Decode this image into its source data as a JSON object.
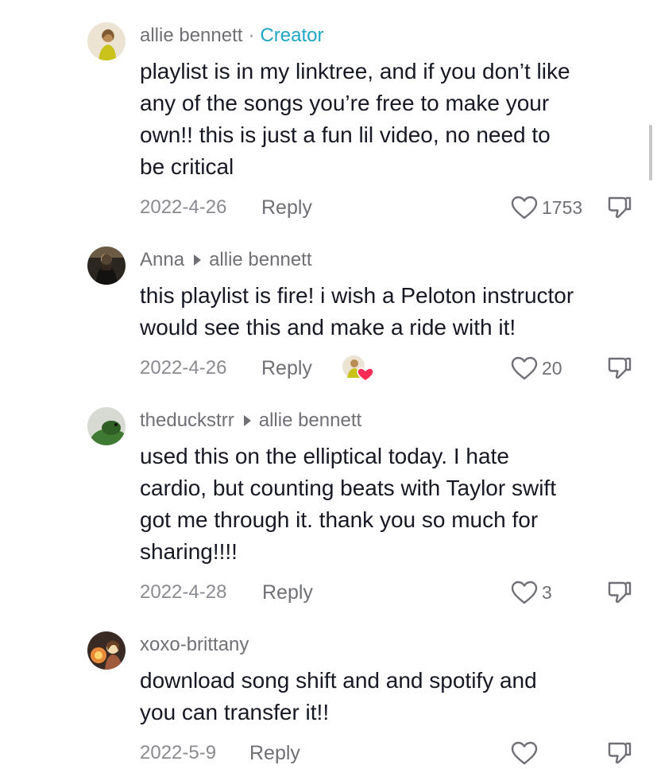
{
  "comments": [
    {
      "username": "allie bennett",
      "separator": "·",
      "badge": "Creator",
      "reply_to": "",
      "text": "playlist is in my linktree, and if you don’t like\nany of the songs you’re free to make your\nown!! this is just a fun lil video, no need to\nbe critical",
      "date": "2022-4-26",
      "reply_label": "Reply",
      "likes": "1753",
      "liked_by_creator": false,
      "avatar_colors": [
        "#e9dcc7",
        "#b98d55",
        "#c9c21a"
      ]
    },
    {
      "username": "Anna",
      "separator": "",
      "badge": "",
      "reply_to": "allie bennett",
      "text": "this playlist is fire! i wish a Peloton instructor\nwould see this and make a ride with it!",
      "date": "2022-4-26",
      "reply_label": "Reply",
      "likes": "20",
      "liked_by_creator": true,
      "avatar_colors": [
        "#2b2620",
        "#6b5a44",
        "#141210"
      ]
    },
    {
      "username": "theduckstrr",
      "separator": "",
      "badge": "",
      "reply_to": "allie bennett",
      "text": "used this on the elliptical today. I hate\ncardio, but counting beats with Taylor swift\ngot me through it. thank you so much for\nsharing!!!!",
      "date": "2022-4-28",
      "reply_label": "Reply",
      "likes": "3",
      "liked_by_creator": false,
      "avatar_colors": [
        "#d7d9d3",
        "#3f7a32",
        "#2f5f24"
      ]
    },
    {
      "username": "xoxo-brittany",
      "separator": "",
      "badge": "",
      "reply_to": "",
      "text": "download song shift and and spotify and\nyou can transfer it!!",
      "date": "2022-5-9",
      "reply_label": "Reply",
      "likes": "",
      "liked_by_creator": false,
      "avatar_colors": [
        "#3a2a24",
        "#e98a3a",
        "#f3d9b0"
      ]
    }
  ],
  "icons": {
    "like": "heart-outline-icon",
    "dislike": "thumbs-down-icon",
    "creator_liked": "creator-liked-heart-icon"
  },
  "colors": {
    "creator_badge": "#1fa6c4",
    "creator_heart": "#fe2c55",
    "text_primary": "#161823",
    "text_secondary": "#6f7076"
  }
}
